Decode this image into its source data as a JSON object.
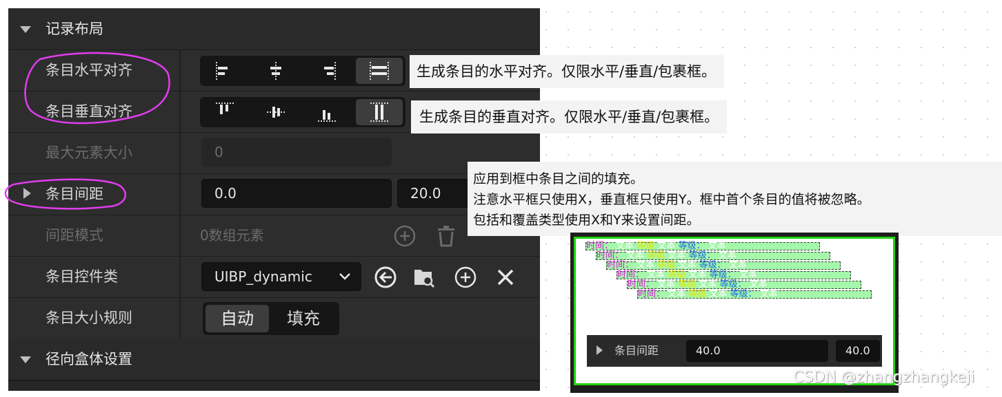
{
  "panel": {
    "category_layout": "记录布局",
    "rows": {
      "h_align": {
        "label": "条目水平对齐"
      },
      "v_align": {
        "label": "条目垂直对齐"
      },
      "max_size": {
        "label": "最大元素大小",
        "value": "0"
      },
      "spacing": {
        "label": "条目间距",
        "x": "0.0",
        "y": "20.0"
      },
      "spacing_mode": {
        "label": "间距模式",
        "value": "0数组元素"
      },
      "widget_class": {
        "label": "条目控件类",
        "value": "UIBP_dynamic"
      },
      "size_rule": {
        "label": "条目大小规则",
        "options": [
          "自动",
          "填充"
        ],
        "selected": "自动"
      }
    },
    "category_radial": "径向盒体设置"
  },
  "tooltips": {
    "h_align": "生成条目的水平对齐。仅限水平/垂直/包裹框。",
    "v_align": "生成条目的垂直对齐。仅限水平/垂直/包裹框。",
    "spacing_lines": [
      "应用到框中条目之间的填充。",
      "注意水平框只使用X，垂直框只使用Y。框中首个条目的值将被忽略。",
      "包括和覆盖类型使用X和Y来设置间距。"
    ]
  },
  "example": {
    "item": {
      "time": "时间：",
      "text1": "文本",
      "level": "等级",
      "level_sep": "等级：",
      "text2": "文本"
    },
    "spacing_label": "条目间距",
    "spacing_x": "40.0",
    "spacing_y": "40.0"
  },
  "watermark": "CSDN @zhangzhangkeji",
  "colors": {
    "panel_bg": "#2d2d2d",
    "annotation": "#e33cf0",
    "example_border": "#22d20f",
    "item_fill": "#a5f7ab"
  }
}
